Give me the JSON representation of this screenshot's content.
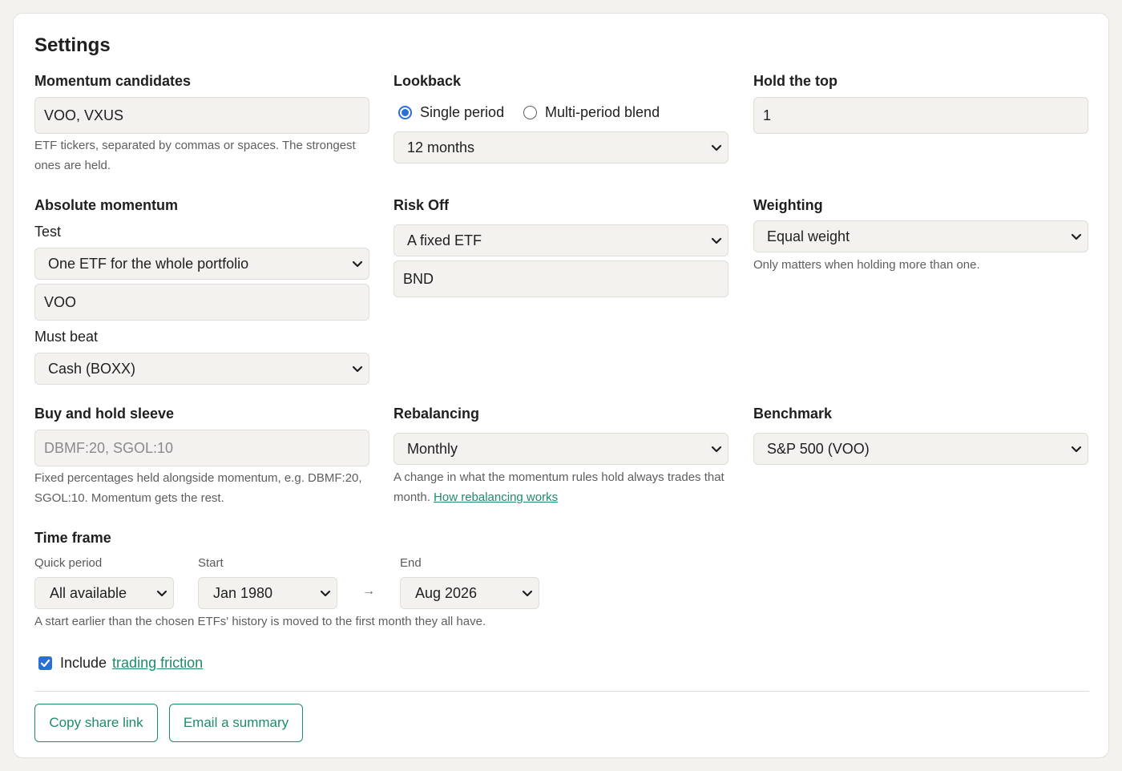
{
  "title": "Settings",
  "momentum": {
    "label": "Momentum candidates",
    "value": "VOO, VXUS",
    "help": "ETF tickers, separated by commas or spaces. The strongest ones are held."
  },
  "lookback": {
    "label": "Lookback",
    "options": [
      "Single period",
      "Multi-period blend"
    ],
    "selected_option": "Single period",
    "period": "12 months"
  },
  "hold_top": {
    "label": "Hold the top",
    "value": "1"
  },
  "absolute": {
    "label": "Absolute momentum",
    "test_label": "Test",
    "test_value": "One ETF for the whole portfolio",
    "etf_value": "VOO",
    "must_beat_label": "Must beat",
    "must_beat_value": "Cash (BOXX)"
  },
  "risk_off": {
    "label": "Risk Off",
    "mode": "A fixed ETF",
    "etf_value": "BND"
  },
  "weighting": {
    "label": "Weighting",
    "value": "Equal weight",
    "help": "Only matters when holding more than one."
  },
  "buy_hold": {
    "label": "Buy and hold sleeve",
    "placeholder": "DBMF:20, SGOL:10",
    "help": "Fixed percentages held alongside momentum, e.g. DBMF:20, SGOL:10. Momentum gets the rest."
  },
  "rebalancing": {
    "label": "Rebalancing",
    "value": "Monthly",
    "help_text": "A change in what the momentum rules hold always trades that month.",
    "help_link": "How rebalancing works"
  },
  "benchmark": {
    "label": "Benchmark",
    "value": "S&P 500 (VOO)"
  },
  "timeframe": {
    "label": "Time frame",
    "quick_label": "Quick period",
    "quick_value": "All available",
    "start_label": "Start",
    "start_value": "Jan 1980",
    "arrow": "→",
    "end_label": "End",
    "end_value": "Aug 2026",
    "help": "A start earlier than the chosen ETFs' history is moved to the first month they all have."
  },
  "friction": {
    "checked": true,
    "text": "Include",
    "link": "trading friction"
  },
  "buttons": {
    "copy": "Copy share link",
    "email": "Email a summary"
  },
  "colors": {
    "accent": "#1e8a6e",
    "control_blue": "#2a6fd6",
    "field_bg": "#f3f2ef"
  }
}
